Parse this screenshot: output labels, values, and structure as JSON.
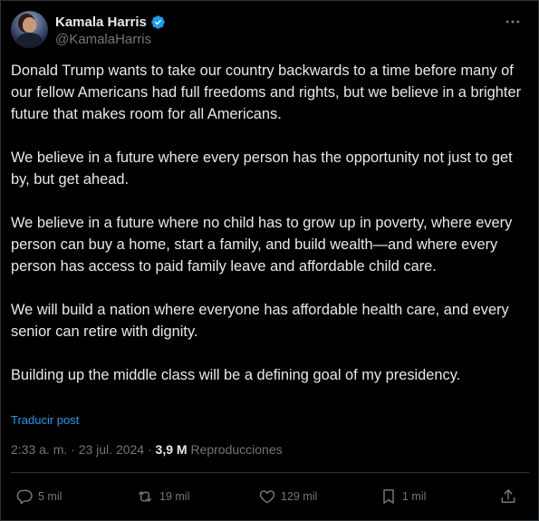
{
  "author": {
    "display_name": "Kamala Harris",
    "handle": "@KamalaHarris",
    "verified": true,
    "verified_color": "#1d9bf0"
  },
  "tweet": {
    "paragraphs": [
      "Donald Trump wants to take our country backwards to a time before many of our fellow Americans had full freedoms and rights, but we believe in a brighter future that makes room for all Americans.",
      "We believe in a future where every person has the opportunity not just to get by, but get ahead.",
      "We believe in a future where no child has to grow up in poverty, where every person can buy a home, start a family, and build wealth—and where every person has access to paid family leave and affordable child care.",
      "We will build a nation where everyone has affordable health care, and every senior can retire with dignity.",
      "Building up the middle class will be a defining goal of my presidency."
    ],
    "translate_label": "Traducir post",
    "timestamp": "2:33 a. m. · 23 jul. 2024",
    "separator": " · ",
    "views_count": "3,9 M",
    "views_label": " Reproducciones"
  },
  "actions": {
    "replies": "5 mil",
    "retweets": "19 mil",
    "likes": "129 mil",
    "bookmarks": "1 mil"
  },
  "icons": {
    "more": "more-dots-icon",
    "reply": "reply-bubble-icon",
    "retweet": "retweet-icon",
    "like": "heart-icon",
    "bookmark": "bookmark-icon",
    "share": "share-upload-icon"
  },
  "colors": {
    "background": "#000000",
    "text": "#e7e9ea",
    "secondary": "#71767b",
    "link": "#1d9bf0",
    "border": "#2f3336"
  }
}
